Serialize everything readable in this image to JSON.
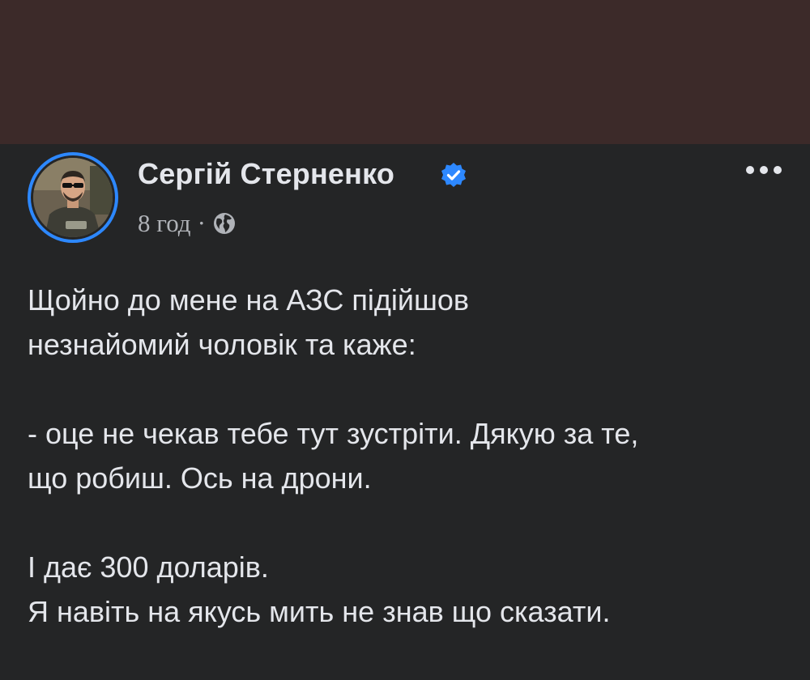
{
  "post": {
    "author": "Сергій Стерненко",
    "verified": true,
    "time": "8 год",
    "separator": "·",
    "audience_icon": "globe-icon",
    "more_icon": "more-options-icon",
    "body": {
      "p1_line1": "Щойно до мене на АЗС підійшов",
      "p1_line2": "незнайомий чоловік та каже:",
      "p2_line1": "- оце не чекав тебе тут зустріти. Дякую за те,",
      "p2_line2": "що робиш. Ось на дрони.",
      "p3_line1": "І дає 300 доларів.",
      "p3_line2": "Я навіть на якусь мить не знав що сказати."
    }
  },
  "colors": {
    "top_band": "#3c2a29",
    "background": "#242526",
    "text_primary": "#e4e6eb",
    "text_secondary": "#b0b3b8",
    "accent": "#2d88ff"
  }
}
